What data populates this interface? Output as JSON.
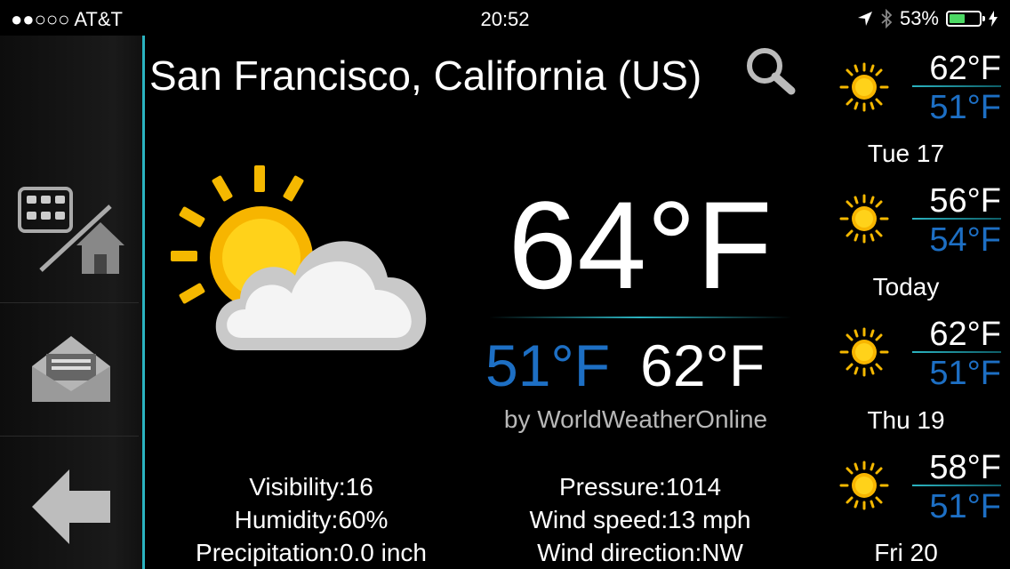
{
  "status_bar": {
    "carrier": "●●○○○ AT&T",
    "time": "20:52",
    "battery_text": "53%",
    "battery_level": 0.53,
    "battery_color": "#4cd964"
  },
  "sidebar": {
    "items": [
      {
        "icon": "grid-home-toggle-icon"
      },
      {
        "icon": "mail-icon"
      },
      {
        "icon": "back-arrow-icon"
      }
    ]
  },
  "location": {
    "title": "San Francisco, California (US)",
    "search_icon": "search-icon"
  },
  "current": {
    "icon": "partly-cloudy-icon",
    "temperature": "64°F",
    "low": "51°F",
    "high": "62°F",
    "source": "by WorldWeatherOnline"
  },
  "details": {
    "visibility": "Visibility:16",
    "humidity": "Humidity:60%",
    "precipitation": "Precipitation:0.0 inch",
    "pressure": "Pressure:1014",
    "wind_speed": "Wind speed:13 mph",
    "wind_direction": "Wind direction:NW"
  },
  "forecast": [
    {
      "high": "62°F",
      "low": "51°F",
      "day": "Tue 17",
      "icon": "sun-icon"
    },
    {
      "high": "56°F",
      "low": "54°F",
      "day": "Today",
      "icon": "sun-icon"
    },
    {
      "high": "62°F",
      "low": "51°F",
      "day": "Thu 19",
      "icon": "sun-icon"
    },
    {
      "high": "58°F",
      "low": "51°F",
      "day": "Fri 20",
      "icon": "sun-icon"
    }
  ],
  "colors": {
    "accent": "#2bb3c0",
    "low_temp": "#1d6fc4"
  }
}
